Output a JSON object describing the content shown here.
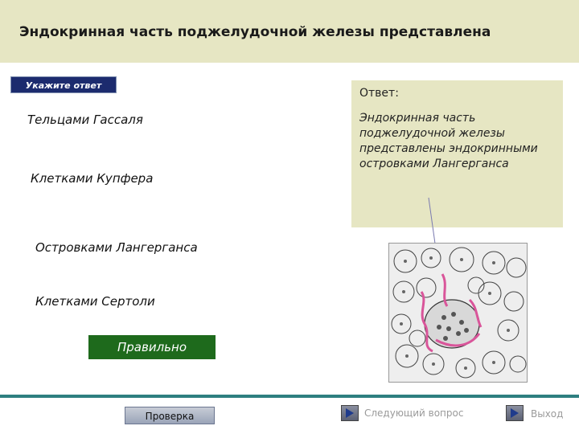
{
  "header": {
    "title": "Эндокринная часть поджелудочной железы представлена"
  },
  "prompt_label": "Укажите ответ",
  "options": [
    {
      "label": "Тельцами Гассаля"
    },
    {
      "label": "Клетками Купфера"
    },
    {
      "label": "Островками Лангерганса"
    },
    {
      "label": "Клетками Сертоли"
    }
  ],
  "result_label": "Правильно",
  "answer": {
    "heading": "Ответ:",
    "text": "Эндокринная часть поджелудочной железы представлены эндокринными островками Лангерганса"
  },
  "footer": {
    "check_label": "Проверка",
    "next_label": "Следующий вопрос",
    "exit_label": "Выход"
  },
  "colors": {
    "header_bg": "#e6e6c3",
    "prompt_bg": "#1c2b6e",
    "correct_bg": "#1e6a1c",
    "footer_line": "#2e7f80",
    "islet_stain": "#d9559a"
  },
  "icons": {
    "next": "play-arrow-icon",
    "exit": "play-arrow-icon"
  }
}
